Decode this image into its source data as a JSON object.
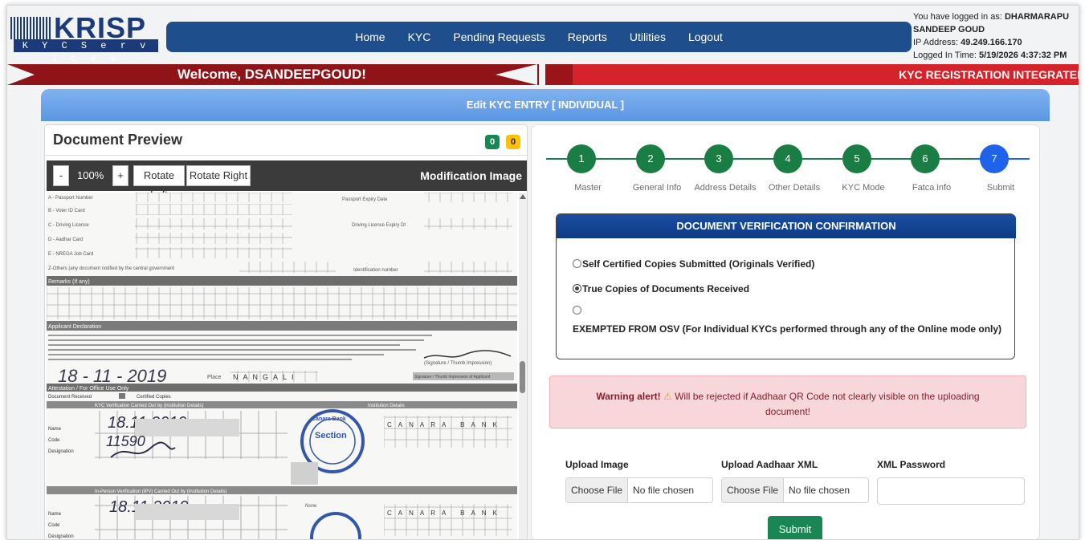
{
  "logo": {
    "name": "KRISP",
    "tagline": "K Y C   S e r v i c e s"
  },
  "nav": [
    "Home",
    "KYC",
    "Pending Requests",
    "Reports",
    "Utilities",
    "Logout"
  ],
  "login": {
    "logged_prefix": "You have logged in as: ",
    "user": "DHARMARAPU SANDEEP GOUD",
    "ip_prefix": "IP Address: ",
    "ip": "49.249.166.170",
    "time_prefix": "Logged In Time: ",
    "time": "5/19/2026 4:37:32 PM"
  },
  "banner": {
    "welcome": "Welcome, DSANDEEPGOUD!",
    "marquee": "KYC REGISTRATION INTEGRATEI"
  },
  "page_title": "Edit KYC ENTRY [ INDIVIDUAL ]",
  "doc_preview": {
    "title": "Document Preview",
    "badge_green": "0",
    "badge_yellow": "0",
    "minus": "-",
    "zoom": "100%",
    "plus": "+",
    "rotate_left": "Rotate Left",
    "rotate_right": "Rotate Right",
    "image_label": "Modification Image"
  },
  "form_doc": {
    "rows": [
      "A - Passport Number",
      "B - Voter ID Card",
      "C - Driving Licence",
      "D - Aadhar Card",
      "E - NREGA Job Card",
      "Z-Others (any document notified by the central government"
    ],
    "passport_expiry": "Passport Expiry Date",
    "licence_expiry": "Driving Licence Expiry Dt",
    "ident_number": "Identification number",
    "remarks": "Remarks (If any)",
    "declaration": "Applicant Declaration",
    "date1": "18 - 11 - 2019",
    "place_label": "Place",
    "place": "NANGALI",
    "sign_label": "Signature / Thumb Impression of Applicant",
    "attest": "Attestation / For Office Use Only",
    "doc_received": "Document Received",
    "certified": "Certified Copies",
    "kyc_verif": "KYC Verification Carried Out by (Institution Details)",
    "inst_details": "Institution Details",
    "name": "Name",
    "code": "Code",
    "designation": "Designation",
    "date2": "18.11.2019",
    "emp_code": "11590",
    "bank": "CANARA BANK",
    "bank2": "CANARA BANK",
    "none": "None",
    "stamp": "Section",
    "stamp_bank": "Canara Bank",
    "ipv": "In-Person Verification (IPV) Carried Out by (Institution Details)"
  },
  "steps": [
    {
      "num": "1",
      "label": "Master"
    },
    {
      "num": "2",
      "label": "General Info"
    },
    {
      "num": "3",
      "label": "Address Details"
    },
    {
      "num": "4",
      "label": "Other Details"
    },
    {
      "num": "5",
      "label": "KYC Mode"
    },
    {
      "num": "6",
      "label": "Fatca info"
    },
    {
      "num": "7",
      "label": "Submit"
    }
  ],
  "verification": {
    "title": "DOCUMENT VERIFICATION CONFIRMATION",
    "opt1": "Self Certified Copies Submitted (Originals Verified)",
    "opt2": "True Copies of Documents Received",
    "opt3": "EXEMPTED FROM OSV (For Individual KYCs performed through any of the Online mode only)",
    "selected": "opt2"
  },
  "warning": {
    "title": "Warning alert!",
    "text": "Will be rejected if Aadhaar QR Code not clearly visible on the uploading document!"
  },
  "upload": {
    "image_label": "Upload Image",
    "xml_label": "Upload Aadhaar XML",
    "pwd_label": "XML Password",
    "choose": "Choose File",
    "no_file": "No file chosen",
    "submit": "Submit"
  },
  "colors": {
    "nav_bg": "#1e4e8c",
    "banner_dark": "#8e1418",
    "banner_red": "#d4232a",
    "step_green": "#1a7d44",
    "step_active": "#1e63e9",
    "submit": "#198754"
  }
}
